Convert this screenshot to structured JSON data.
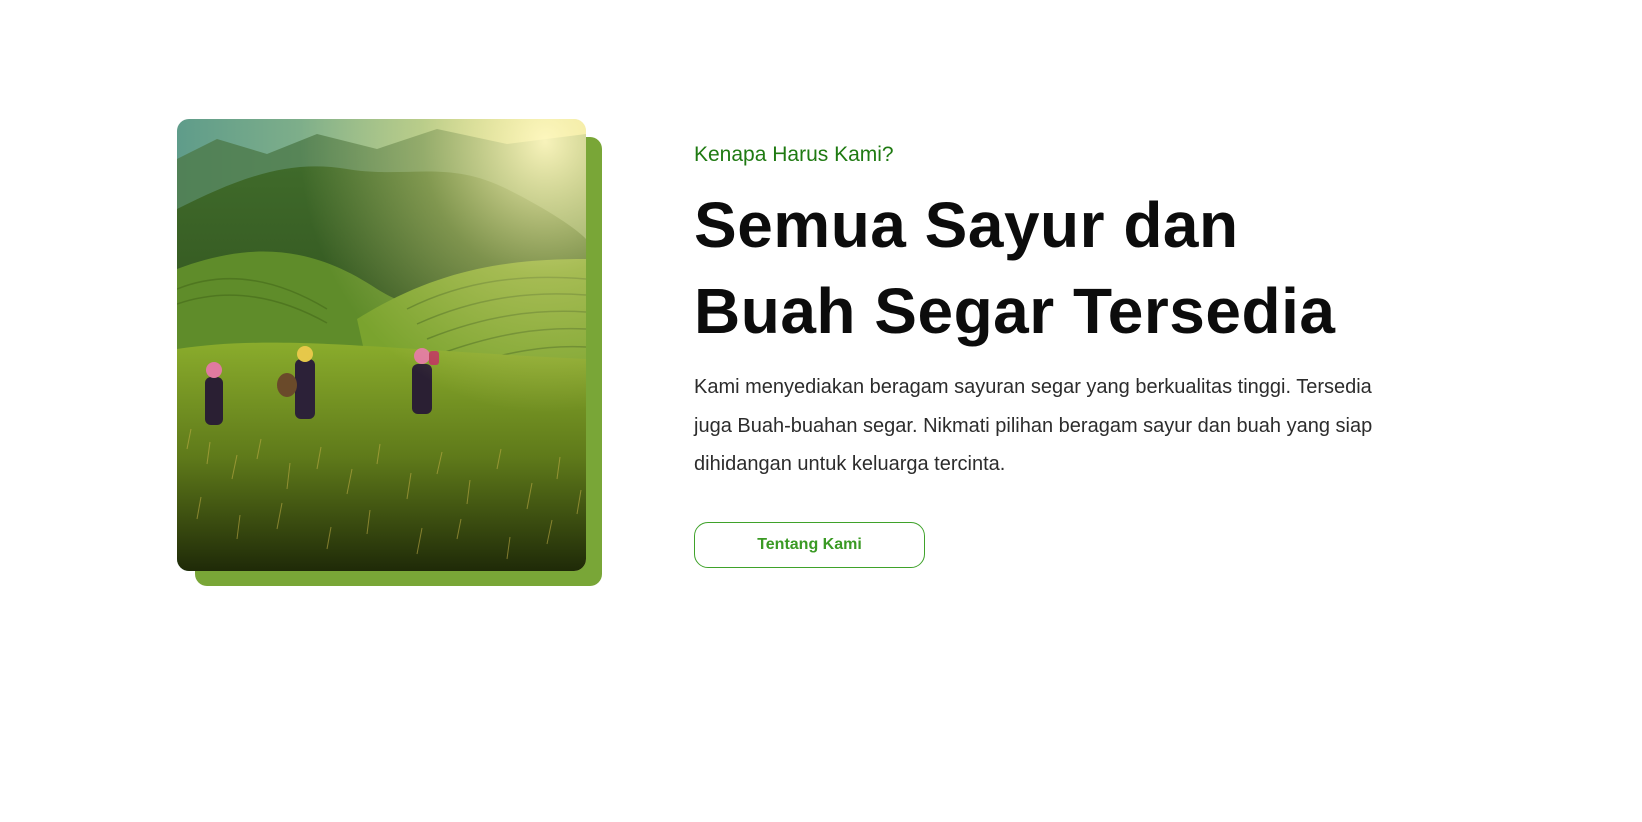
{
  "section": {
    "image_alt": "Rice terraces with farmers walking",
    "eyebrow": "Kenapa Harus Kami?",
    "headline_line1": "Semua Sayur dan",
    "headline_line2": "Buah Segar Tersedia",
    "description": "Kami menyediakan beragam sayuran segar yang berkualitas tinggi. Tersedia juga Buah-buahan segar. Nikmati pilihan beragam sayur dan buah yang siap dihidangan untuk keluarga tercinta.",
    "button_label": "Tentang Kami"
  },
  "colors": {
    "accent_green": "#79a637",
    "eyebrow_green": "#1f7a12",
    "button_green": "#3a9a24",
    "headline": "#0c0c0c",
    "body_text": "#2c2c2c"
  }
}
